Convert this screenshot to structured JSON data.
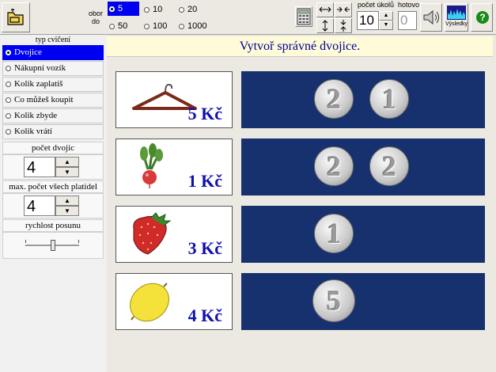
{
  "toolbar": {
    "range_label_top": "obor",
    "range_label_bottom": "do",
    "ranges": [
      {
        "label": "5",
        "selected": true
      },
      {
        "label": "10",
        "selected": false
      },
      {
        "label": "20",
        "selected": false
      },
      {
        "label": "50",
        "selected": false
      },
      {
        "label": "100",
        "selected": false
      },
      {
        "label": "1000",
        "selected": false
      }
    ],
    "task_count_label": "počet úkolů",
    "task_count_value": "10",
    "done_label": "hotovo",
    "done_value": "0",
    "results_label": "Výsledky",
    "help_glyph": "?"
  },
  "left": {
    "type_label": "typ cvičení",
    "exercises": [
      {
        "label": "Dvojice",
        "selected": true
      },
      {
        "label": "Nákupní vozík",
        "selected": false
      },
      {
        "label": "Kolik zaplatíš",
        "selected": false
      },
      {
        "label": "Co můžeš koupit",
        "selected": false
      },
      {
        "label": "Kolik zbyde",
        "selected": false
      },
      {
        "label": "Kolik vrátí",
        "selected": false
      }
    ],
    "pairs_label": "počet dvojic",
    "pairs_value": "4",
    "max_coins_label": "max. počet všech platidel",
    "max_coins_value": "4",
    "speed_label": "rychlost posunu",
    "speed_level": 0.5
  },
  "main": {
    "instruction": "Vytvoř správné dvojice.",
    "items": [
      {
        "icon": "hanger-icon",
        "price": "5 Kč",
        "coins": [
          "2",
          "1"
        ]
      },
      {
        "icon": "radish-icon",
        "price": "1 Kč",
        "coins": [
          "2",
          "2"
        ]
      },
      {
        "icon": "strawberry-icon",
        "price": "3 Kč",
        "coins": [
          "1"
        ]
      },
      {
        "icon": "lemon-icon",
        "price": "4 Kč",
        "coins": [
          "5"
        ]
      }
    ]
  }
}
